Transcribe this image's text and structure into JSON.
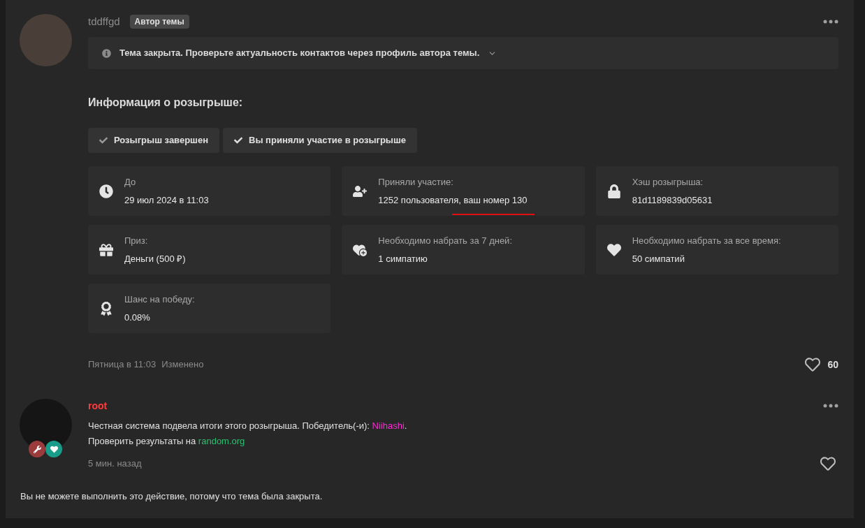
{
  "post": {
    "author": "tddffgd",
    "author_badge": "Автор темы",
    "notice": "Тема закрыта. Проверьте актуальность контактов через профиль автора темы.",
    "heading": "Информация о розыгрыше:",
    "status_buttons": [
      "Розыгрыш завершен",
      "Вы приняли участие в розыгрыше"
    ],
    "info_cards": [
      {
        "kind": "clock",
        "label": "До",
        "value": "29 июл 2024 в 11:03",
        "annotated": false
      },
      {
        "kind": "participants",
        "label": "Приняли участие:",
        "value": "1252 пользователя, ваш номер 130",
        "annotated": true
      },
      {
        "kind": "hash",
        "label": "Хэш розыгрыша:",
        "value": "81d1189839d05631",
        "annotated": false
      },
      {
        "kind": "prize",
        "label": "Приз:",
        "value": "Деньги (500 ₽)",
        "annotated": false
      },
      {
        "kind": "weekly",
        "label": "Необходимо набрать за 7 дней:",
        "value": "1 симпатию",
        "annotated": false
      },
      {
        "kind": "total",
        "label": "Необходимо набрать за все время:",
        "value": "50 симпатий",
        "annotated": false
      },
      {
        "kind": "chance",
        "label": "Шанс на победу:",
        "value": "0.08%",
        "annotated": false
      }
    ],
    "date": "Пятница в 11:03",
    "edited": "Изменено",
    "likes": "60"
  },
  "reply": {
    "author": "root",
    "line_1": {
      "text": "Честная система подвела итоги этого розыгрыша. Победитель(-и): ",
      "winner": "Niihashi",
      "after": "."
    },
    "line_2": {
      "text": "Проверить результаты на ",
      "link": "random.org"
    },
    "date": "5 мин. назад"
  },
  "closed_message": "Вы не можете выполнить это действие, потому что тема была закрыта."
}
